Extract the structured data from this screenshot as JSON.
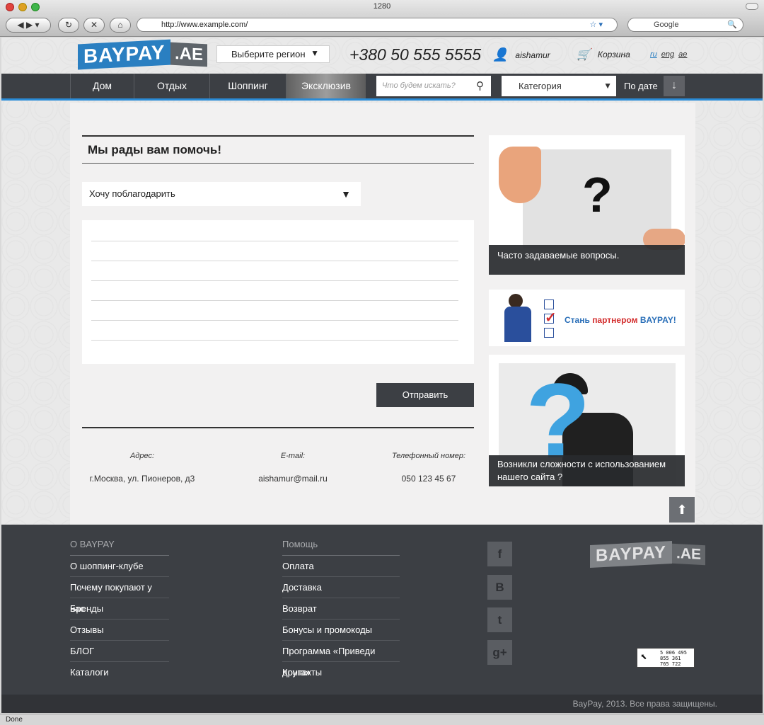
{
  "browser": {
    "window_title": "1280",
    "url": "http://www.example.com/",
    "search_placeholder": "Google",
    "status": "Done"
  },
  "header": {
    "logo_main": "BAYPAY",
    "logo_suffix": ".AE",
    "region_select": "Выберите регион",
    "phone": "+380 50 555 5555",
    "username": "aishamur",
    "cart_label": "Корзина",
    "langs": [
      "ru",
      "eng",
      "ae"
    ]
  },
  "nav": {
    "items": [
      "Дом",
      "Отдых",
      "Шоппинг",
      "Эксклюзив"
    ],
    "search_placeholder": "Что будем искать?",
    "category": "Категория",
    "sort_label": "По дате"
  },
  "form": {
    "title": "Мы рады вам помочь!",
    "topic": "Хочу поблагодарить",
    "submit": "Отправить"
  },
  "contacts": {
    "address_label": "Адрес:",
    "address": "г.Москва, ул. Пионеров, д3",
    "email_label": "E-mail:",
    "email": "aishamur@mail.ru",
    "phone_label": "Телефонный номер:",
    "phone": "050 123 45 67"
  },
  "sidebar": {
    "faq": "Часто задаваемые вопросы.",
    "partner_prefix": "Стань",
    "partner_highlight": "партнером",
    "partner_suffix": "BAYPAY!",
    "help": "Возникли сложности с использованием нашего сайта ?"
  },
  "footer": {
    "col1_head": "О BAYPAY",
    "col1": [
      "О шоппинг-клубе",
      "Почему покупают у нас",
      "Бренды",
      "Отзывы",
      "БЛОГ",
      "Каталоги"
    ],
    "col2_head": "Помощь",
    "col2": [
      "Оплата",
      "Доставка",
      "Возврат",
      "Бонусы и промокоды",
      "Программа «Приведи друга»",
      "Контакты"
    ],
    "social": [
      "f",
      "B",
      "t",
      "g+"
    ],
    "counter": [
      "5 006 495",
      "855 361",
      "765 722"
    ],
    "copyright": "BayPay, 2013. Все права защищены."
  },
  "colors": {
    "brand_blue": "#2a7fc1",
    "dark": "#3c3f44",
    "partner_red": "#d32c2c"
  }
}
